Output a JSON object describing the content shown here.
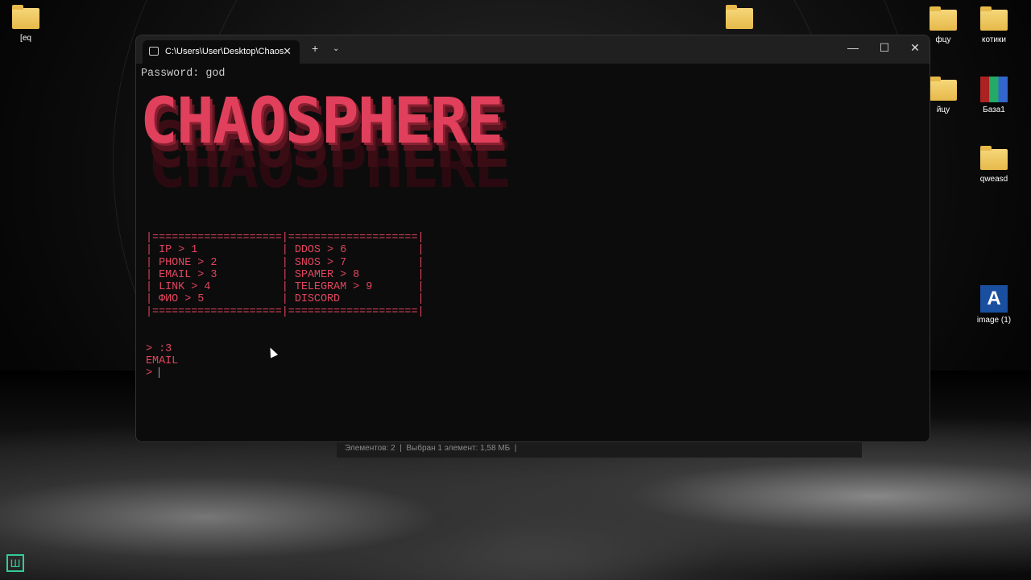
{
  "desktop": {
    "icons": [
      {
        "label": "[eq"
      },
      {
        "label": ""
      },
      {
        "label": "фцу"
      },
      {
        "label": "котики"
      },
      {
        "label": "йцу"
      },
      {
        "label": "База1"
      },
      {
        "label": "qweasd"
      },
      {
        "label": "image (1)"
      }
    ]
  },
  "explorer_status": {
    "count": "Элементов: 2",
    "selection": "Выбран 1 элемент: 1,58 МБ"
  },
  "terminal": {
    "tab_title": "C:\\Users\\User\\Desktop\\Chaos",
    "password_line": "Password: god",
    "logo": "CHAOSPHERE",
    "menu_border": "|====================|====================|",
    "menu_rows": [
      "| IP > 1             | DDOS > 6           |",
      "| PHONE > 2          | SNOS > 7           |",
      "| EMAIL > 3          | SPAMER > 8         |",
      "| LINK > 4           | TELEGRAM > 9       |",
      "| ФИО > 5            | DISCORD            |"
    ],
    "input_line": "> :3",
    "output_line": "EMAIL",
    "prompt": "> "
  },
  "colors": {
    "accent": "#e0455e",
    "background": "#0c0c0c"
  }
}
